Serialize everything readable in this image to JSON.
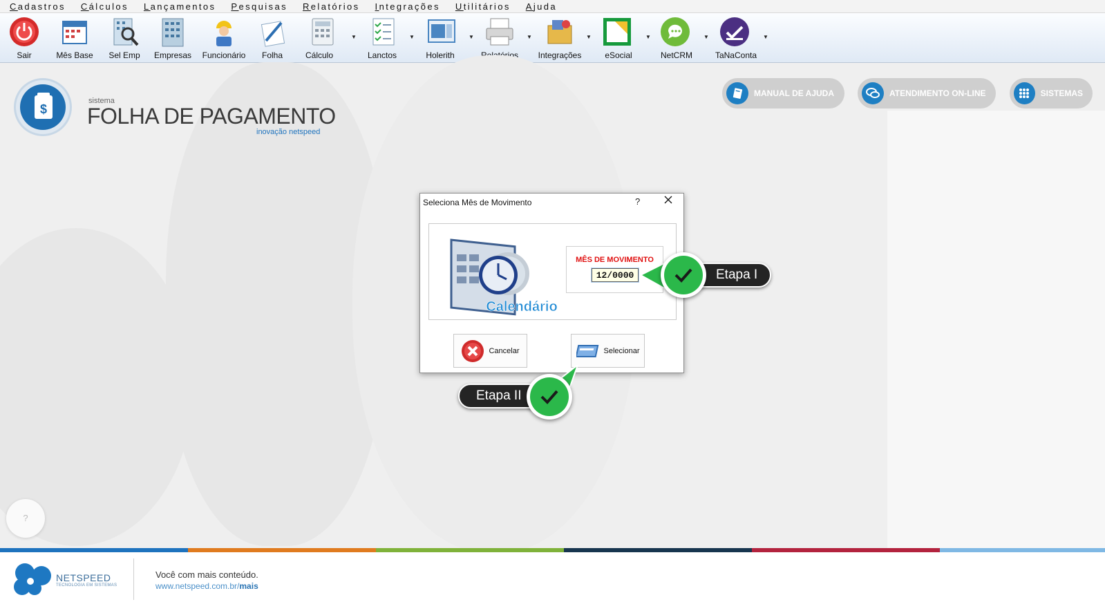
{
  "menu": [
    "Cadastros",
    "Cálculos",
    "Lançamentos",
    "Pesquisas",
    "Relatórios",
    "Integrações",
    "Utilitários",
    "Ajuda"
  ],
  "toolbar": {
    "sair": "Sair",
    "mes_base": "Mês Base",
    "sel_emp": "Sel Emp",
    "empresas": "Empresas",
    "funcionario": "Funcionário",
    "folha": "Folha",
    "calculo": "Cálculo",
    "lanctos": "Lanctos",
    "holerith": "Holerith",
    "relatorios": "Relatórios",
    "integracoes": "Integrações",
    "esocial": "eSocial",
    "netcrm": "NetCRM",
    "tanaconta": "TaNaConta"
  },
  "brand": {
    "small": "sistema",
    "title": "FOLHA DE PAGAMENTO",
    "sub": "inovação netspeed"
  },
  "actions": {
    "manual": "MANUAL DE AJUDA",
    "atendimento": "ATENDIMENTO ON-LINE",
    "sistemas": "SISTEMAS"
  },
  "dialog": {
    "title": "Seleciona Mês de Movimento",
    "help": "?",
    "image_caption": "Calendário",
    "mes_label": "MÊS DE MOVIMENTO",
    "mes_value": "12/0000",
    "cancel": "Cancelar",
    "select": "Selecionar"
  },
  "callouts": {
    "step1": "Etapa I",
    "step2": "Etapa II"
  },
  "help_bubble": "?",
  "footer": {
    "brand": "NETSPEED",
    "tagline": "TECNOLOGIA EM SISTEMAS",
    "line1": "Você com mais conteúdo.",
    "url_prefix": "www.netspeed.com.br/",
    "url_suffix": "mais"
  },
  "colors": {
    "accent_blue": "#1e7fc3",
    "check_green": "#2bb84a",
    "red_label": "#e01010"
  }
}
